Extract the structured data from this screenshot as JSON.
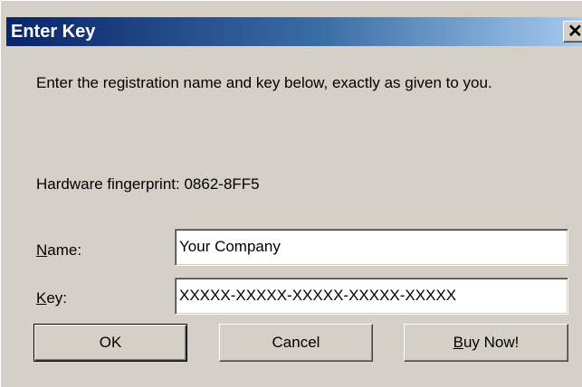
{
  "window": {
    "title": "Enter Key",
    "close_glyph": "✕"
  },
  "description": "Enter the registration name and key below, exactly as given to you.",
  "fingerprint": {
    "text": "Hardware fingerprint: 0862-8FF5"
  },
  "form": {
    "name": {
      "label_accel": "N",
      "label_rest": "ame:",
      "value": "Your Company"
    },
    "key": {
      "label_accel": "K",
      "label_rest": "ey:",
      "value": "XXXXX-XXXXX-XXXXX-XXXXX-XXXXX"
    }
  },
  "buttons": {
    "ok": "OK",
    "cancel": "Cancel",
    "buy_accel": "B",
    "buy_rest": "uy Now!"
  }
}
